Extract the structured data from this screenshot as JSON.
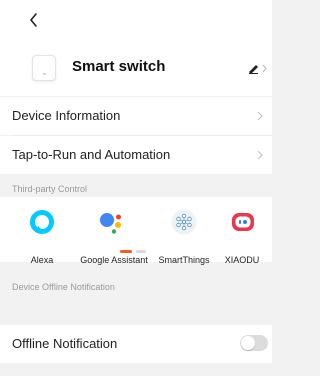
{
  "device": {
    "name": "Smart switch"
  },
  "menu": {
    "device_info": "Device Information",
    "tap_to_run": "Tap-to-Run and Automation"
  },
  "third_party": {
    "section_title": "Third-party Control",
    "items": [
      {
        "label": "Alexa",
        "icon": "alexa-icon"
      },
      {
        "label": "Google Assistant",
        "icon": "google-assistant-icon"
      },
      {
        "label": "SmartThings",
        "icon": "smartthings-icon"
      },
      {
        "label": "XIAODU",
        "icon": "xiaodu-icon"
      }
    ],
    "page_indicator": {
      "active": 0,
      "count": 2
    }
  },
  "offline": {
    "section_title": "Device Offline Notification",
    "label": "Offline Notification",
    "enabled": false
  },
  "colors": {
    "accent": "#ff5a28",
    "alexa": "#00caff",
    "xiaodu": "#e8384f"
  }
}
